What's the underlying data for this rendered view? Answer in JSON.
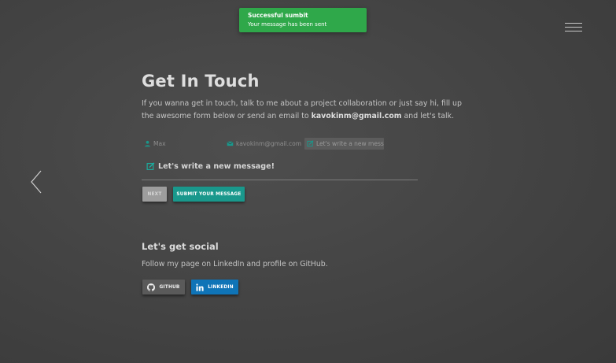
{
  "toast": {
    "title": "Successful sumbit",
    "text": "Your message has been sent",
    "color": "#2fa84a"
  },
  "nav": {
    "menu_icon": "hamburger-icon",
    "prev_icon": "chevron-left-icon"
  },
  "contact": {
    "title": "Get In Touch",
    "intro_before": "If you wanna get in touch, talk to me about a project collaboration or just say hi, fill up the awesome form below or send an email to ",
    "email": "kavokinm@gmail.com",
    "intro_after": " and let's talk."
  },
  "form": {
    "name_value": "Max",
    "name_icon": "user-icon",
    "email_value": "kavokinm@gmail.com",
    "email_icon": "envelope-icon",
    "message_value": "Let's write a new message!",
    "message_icon": "edit-icon",
    "current_step_label": "Let's write a new message!",
    "next_label": "NEXT",
    "submit_label": "SUBMIT YOUR MESSAGE",
    "submit_color": "#19988c"
  },
  "social": {
    "title": "Let's get social",
    "text": "Follow my page on LinkedIn and profile on GitHub.",
    "github_label": "GITHUB",
    "github_icon": "github-icon",
    "linkedin_label": "LINKEDIN",
    "linkedin_icon": "linkedin-icon",
    "linkedin_color": "#0f74b7"
  }
}
